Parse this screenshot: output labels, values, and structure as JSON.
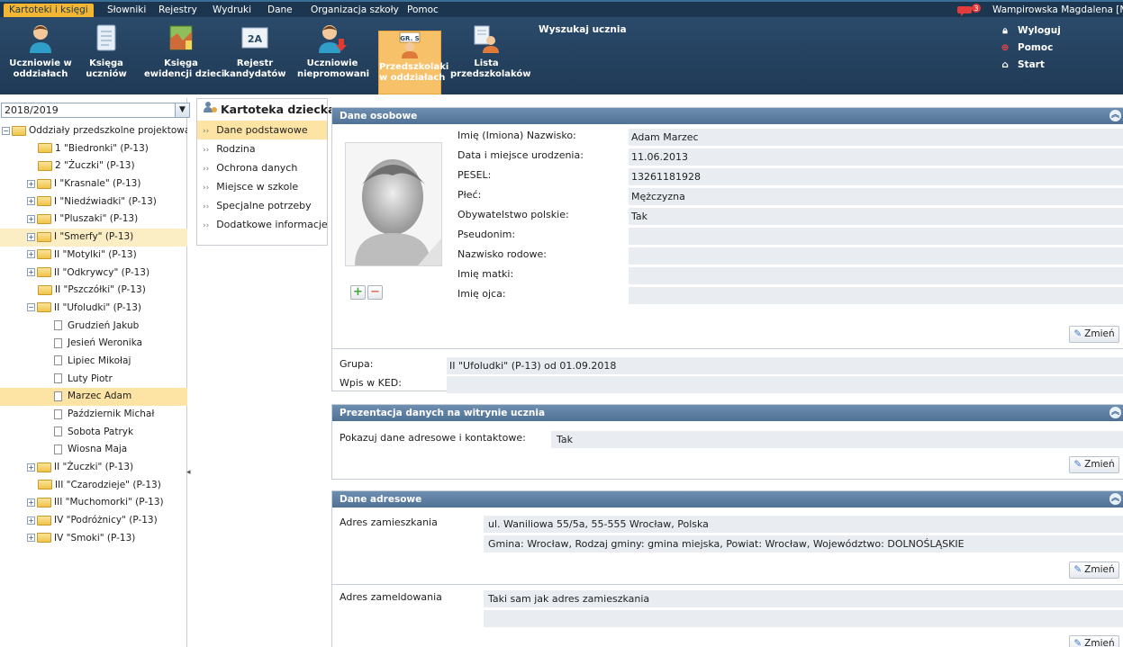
{
  "menu": {
    "items": [
      "Kartoteki i księgi",
      "Słowniki",
      "Rejestry",
      "Wydruki",
      "Dane",
      "Organizacja szkoły",
      "Pomoc"
    ],
    "active_index": 0,
    "notification_count": "3",
    "user_name": "Wampirowska Magdalena [MV"
  },
  "toolbar": {
    "buttons": [
      "Uczniowie w\noddziałach",
      "Księga\nuczniów",
      "Księga\newidencji dzieci",
      "Rejestr\nkandydatów",
      "Uczniowie\nniepromowani",
      "Przedszkolaki\nw oddziałach",
      "Lista\nprzedszkolaków"
    ],
    "active_index": 5,
    "search_label": "Wyszukaj ucznia",
    "icon_text_rejestr": "2A",
    "icon_text_przedszkolaki": "GR. S",
    "right_links": [
      "Wyloguj",
      "Pomoc",
      "Start"
    ]
  },
  "tree": {
    "year": "2018/2019",
    "root": "Oddziały przedszkolne projektowa",
    "groups": [
      {
        "label": "1 \"Biedronki\" (P-13)",
        "expander": false,
        "open": false
      },
      {
        "label": "2 \"Żuczki\" (P-13)",
        "expander": false,
        "open": false
      },
      {
        "label": "I \"Krasnale\" (P-13)",
        "expander": true,
        "open": false
      },
      {
        "label": "I \"Niedźwiadki\" (P-13)",
        "expander": true,
        "open": false
      },
      {
        "label": "I \"Pluszaki\" (P-13)",
        "expander": true,
        "open": false
      },
      {
        "label": "I \"Smerfy\" (P-13)",
        "expander": true,
        "open": false,
        "highlight": true
      },
      {
        "label": "II \"Motylki\" (P-13)",
        "expander": true,
        "open": false
      },
      {
        "label": "II \"Odkrywcy\" (P-13)",
        "expander": true,
        "open": false
      },
      {
        "label": "II \"Pszczółki\" (P-13)",
        "expander": false,
        "open": false
      },
      {
        "label": "II \"Ufoludki\" (P-13)",
        "expander": true,
        "open": true,
        "children": [
          "Grudzień Jakub",
          "Jesień Weronika",
          "Lipiec Mikołaj",
          "Luty Piotr",
          "Marzec Adam",
          "Październik Michał",
          "Sobota Patryk",
          "Wiosna Maja"
        ],
        "selected_child": "Marzec Adam"
      },
      {
        "label": "II \"Żuczki\" (P-13)",
        "expander": true,
        "open": false
      },
      {
        "label": "III \"Czarodzieje\" (P-13)",
        "expander": false,
        "open": false
      },
      {
        "label": "III \"Muchomorki\" (P-13)",
        "expander": true,
        "open": false
      },
      {
        "label": "IV \"Podróżnicy\" (P-13)",
        "expander": true,
        "open": false
      },
      {
        "label": "IV \"Smoki\" (P-13)",
        "expander": true,
        "open": false
      }
    ]
  },
  "tabs": {
    "title": "Kartoteka dziecka",
    "items": [
      "Dane podstawowe",
      "Rodzina",
      "Ochrona danych",
      "Miejsce w szkole",
      "Specjalne potrzeby",
      "Dodatkowe informacje"
    ],
    "active_index": 0
  },
  "personal": {
    "header": "Dane osobowe",
    "fields": [
      {
        "label": "Imię (Imiona) Nazwisko:",
        "value": "Adam Marzec"
      },
      {
        "label": "Data i miejsce urodzenia:",
        "value": "11.06.2013"
      },
      {
        "label": "PESEL:",
        "value": "13261181928"
      },
      {
        "label": "Płeć:",
        "value": "Mężczyzna"
      },
      {
        "label": "Obywatelstwo polskie:",
        "value": "Tak"
      },
      {
        "label": "Pseudonim:",
        "value": ""
      },
      {
        "label": "Nazwisko rodowe:",
        "value": ""
      },
      {
        "label": "Imię matki:",
        "value": ""
      },
      {
        "label": "Imię ojca:",
        "value": ""
      }
    ],
    "change_label": "Zmień",
    "group_label": "Grupa:",
    "group_value": "II \"Ufoludki\" (P-13)  od 01.09.2018",
    "ked_label": "Wpis w KED:",
    "ked_value": ""
  },
  "presentation": {
    "header": "Prezentacja danych na witrynie ucznia",
    "label": "Pokazuj dane adresowe i kontaktowe:",
    "value": "Tak",
    "change_label": "Zmień"
  },
  "address": {
    "header": "Dane adresowe",
    "residence_label": "Adres zamieszkania",
    "residence_line1": "ul. Waniliowa 55/5a, 55-555 Wrocław, Polska",
    "residence_line2": "Gmina: Wrocław, Rodzaj gminy: gmina miejska, Powiat: Wrocław, Województwo: DOLNOŚLĄSKIE",
    "registration_label": "Adres zameldowania",
    "registration_line1": "Taki sam jak adres zamieszkania",
    "registration_line2": "",
    "change_label": "Zmień"
  },
  "colors": {
    "menubar": "#1d3650",
    "toolbar": "#2b4a6a",
    "active_tab": "#f2b632",
    "section_header": "#5f80a3",
    "selection": "#fde3a4"
  }
}
